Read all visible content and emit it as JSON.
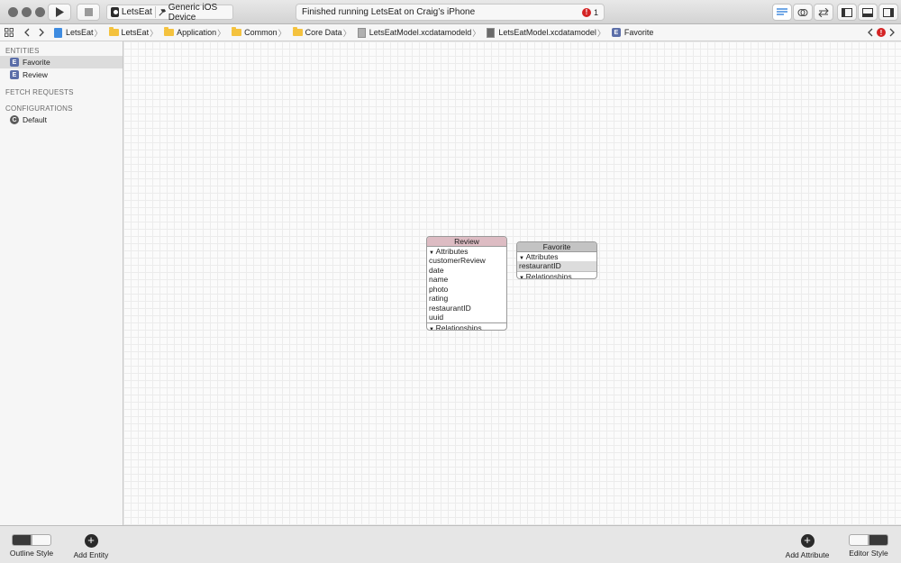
{
  "toolbar": {
    "scheme_app": "LetsEat",
    "scheme_device": "Generic iOS Device",
    "activity_message": "Finished running LetsEat on Craig’s iPhone",
    "error_count": "1"
  },
  "jumpbar": {
    "crumbs": [
      "LetsEat",
      "LetsEat",
      "Application",
      "Common",
      "Core Data",
      "LetsEatModel.xcdatamodeld",
      "LetsEatModel.xcdatamodel",
      "Favorite"
    ]
  },
  "sidebar": {
    "entities_header": "ENTITIES",
    "entities": [
      "Favorite",
      "Review"
    ],
    "fetch_requests_header": "FETCH REQUESTS",
    "configurations_header": "CONFIGURATIONS",
    "configurations": [
      "Default"
    ],
    "entity_icon_letter": "E",
    "config_icon_letter": "C"
  },
  "diagram": {
    "review": {
      "title": "Review",
      "attributes_label": "Attributes",
      "attributes": [
        "customerReview",
        "date",
        "name",
        "photo",
        "rating",
        "restaurantID",
        "uuid"
      ],
      "relationships_label": "Relationships"
    },
    "favorite": {
      "title": "Favorite",
      "attributes_label": "Attributes",
      "attributes": [
        "restaurantID"
      ],
      "relationships_label": "Relationships"
    }
  },
  "bottombar": {
    "outline_style": "Outline Style",
    "add_entity": "Add Entity",
    "add_attribute": "Add Attribute",
    "editor_style": "Editor Style"
  }
}
